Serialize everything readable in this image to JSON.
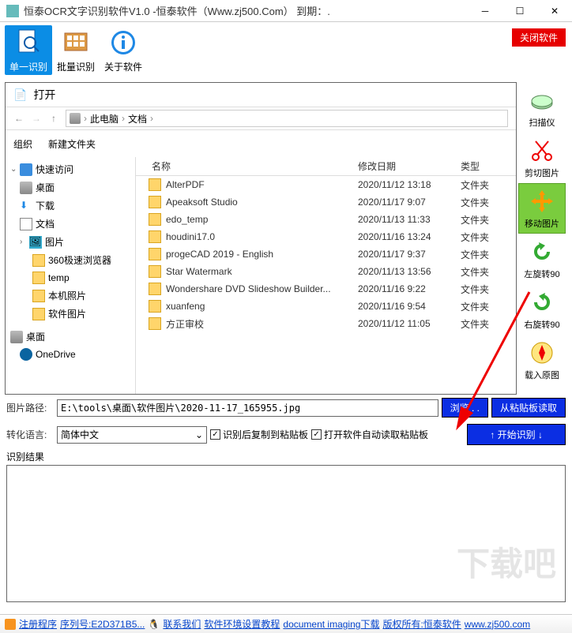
{
  "window": {
    "title": "恒泰OCR文字识别软件V1.0 -恒泰软件（Www.zj500.Com） 到期：."
  },
  "toolbar": {
    "single": "单一识别",
    "batch": "批量识别",
    "about": "关于软件",
    "close_soft": "关闭软件"
  },
  "filedlg": {
    "title": "打开",
    "crumb1": "此电脑",
    "crumb2": "文档",
    "org": "组织",
    "newfolder": "新建文件夹",
    "col_name": "名称",
    "col_date": "修改日期",
    "col_type": "类型",
    "tree": {
      "quick": "快速访问",
      "desktop": "桌面",
      "download": "下载",
      "docs": "文档",
      "pics": "图片",
      "browser": "360极速浏览器",
      "temp": "temp",
      "localpics": "本机照片",
      "softpics": "软件图片",
      "desk2": "桌面",
      "onedrive": "OneDrive"
    },
    "rows": [
      {
        "name": "AlterPDF",
        "date": "2020/11/12 13:18",
        "type": "文件夹"
      },
      {
        "name": "Apeaksoft Studio",
        "date": "2020/11/17 9:07",
        "type": "文件夹"
      },
      {
        "name": "edo_temp",
        "date": "2020/11/13 11:33",
        "type": "文件夹"
      },
      {
        "name": "houdini17.0",
        "date": "2020/11/16 13:24",
        "type": "文件夹"
      },
      {
        "name": "progeCAD 2019 - English",
        "date": "2020/11/17 9:37",
        "type": "文件夹"
      },
      {
        "name": "Star Watermark",
        "date": "2020/11/13 13:56",
        "type": "文件夹"
      },
      {
        "name": "Wondershare DVD Slideshow Builder...",
        "date": "2020/11/16 9:22",
        "type": "文件夹"
      },
      {
        "name": "xuanfeng",
        "date": "2020/11/16 9:54",
        "type": "文件夹"
      },
      {
        "name": "方正审校",
        "date": "2020/11/12 11:05",
        "type": "文件夹"
      }
    ]
  },
  "sidetools": {
    "scanner": "扫描仪",
    "cut": "剪切图片",
    "move": "移动图片",
    "rotl": "左旋转90",
    "rotr": "右旋转90",
    "loadorig": "载入原图"
  },
  "controls": {
    "path_label": "图片路径:",
    "path_value": "E:\\tools\\桌面\\软件图片\\2020-11-17_165955.jpg",
    "browse": "浏览 . .",
    "from_clip": "从粘贴板读取",
    "lang_label": "转化语言:",
    "lang_value": "简体中文",
    "chk_copy": "识别后复制到粘贴板",
    "chk_auto": "打开软件自动读取粘贴板",
    "start": "↑ 开始识别 ↓",
    "result_label": "识别结果"
  },
  "status": {
    "reg": "注册程序",
    "serial": "序列号:E2D371B5...",
    "contact": "联系我们",
    "env": "软件环境设置教程",
    "doc": "document imaging下载",
    "copy": "版权所有:恒泰软件",
    "site": "www.zj500.com"
  },
  "watermark": "下载吧"
}
